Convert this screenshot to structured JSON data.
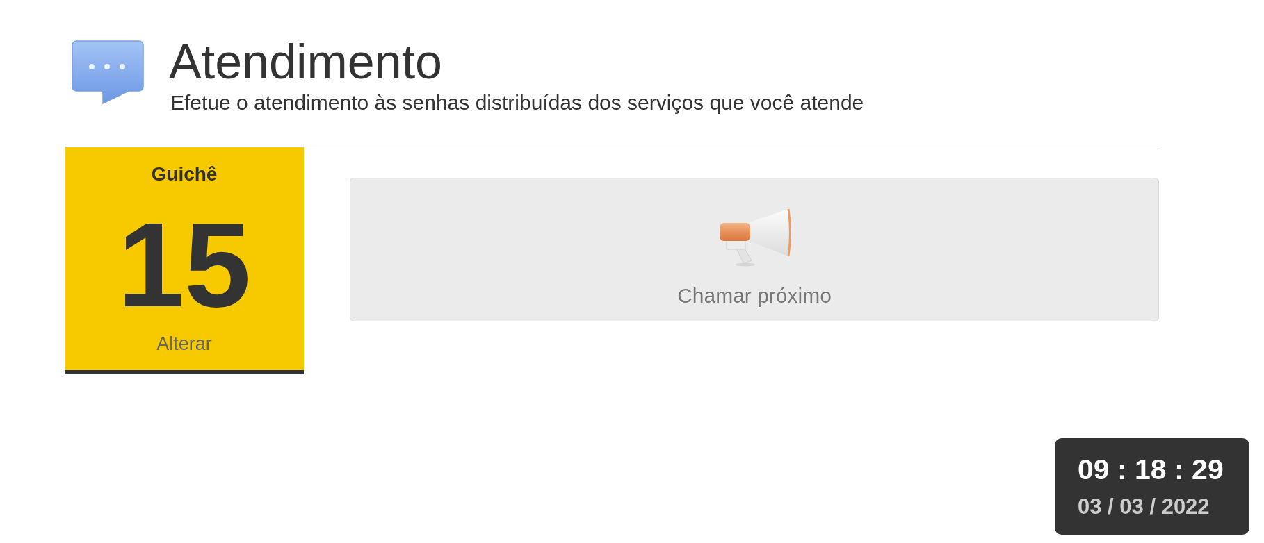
{
  "header": {
    "title": "Atendimento",
    "subtitle": "Efetue o atendimento às senhas distribuídas dos serviços que você atende"
  },
  "counter": {
    "label": "Guichê",
    "number": "15",
    "change_link": "Alterar"
  },
  "call_button": {
    "label": "Chamar próximo"
  },
  "clock": {
    "time": "09 : 18 : 29",
    "date": "03 / 03 / 2022"
  }
}
